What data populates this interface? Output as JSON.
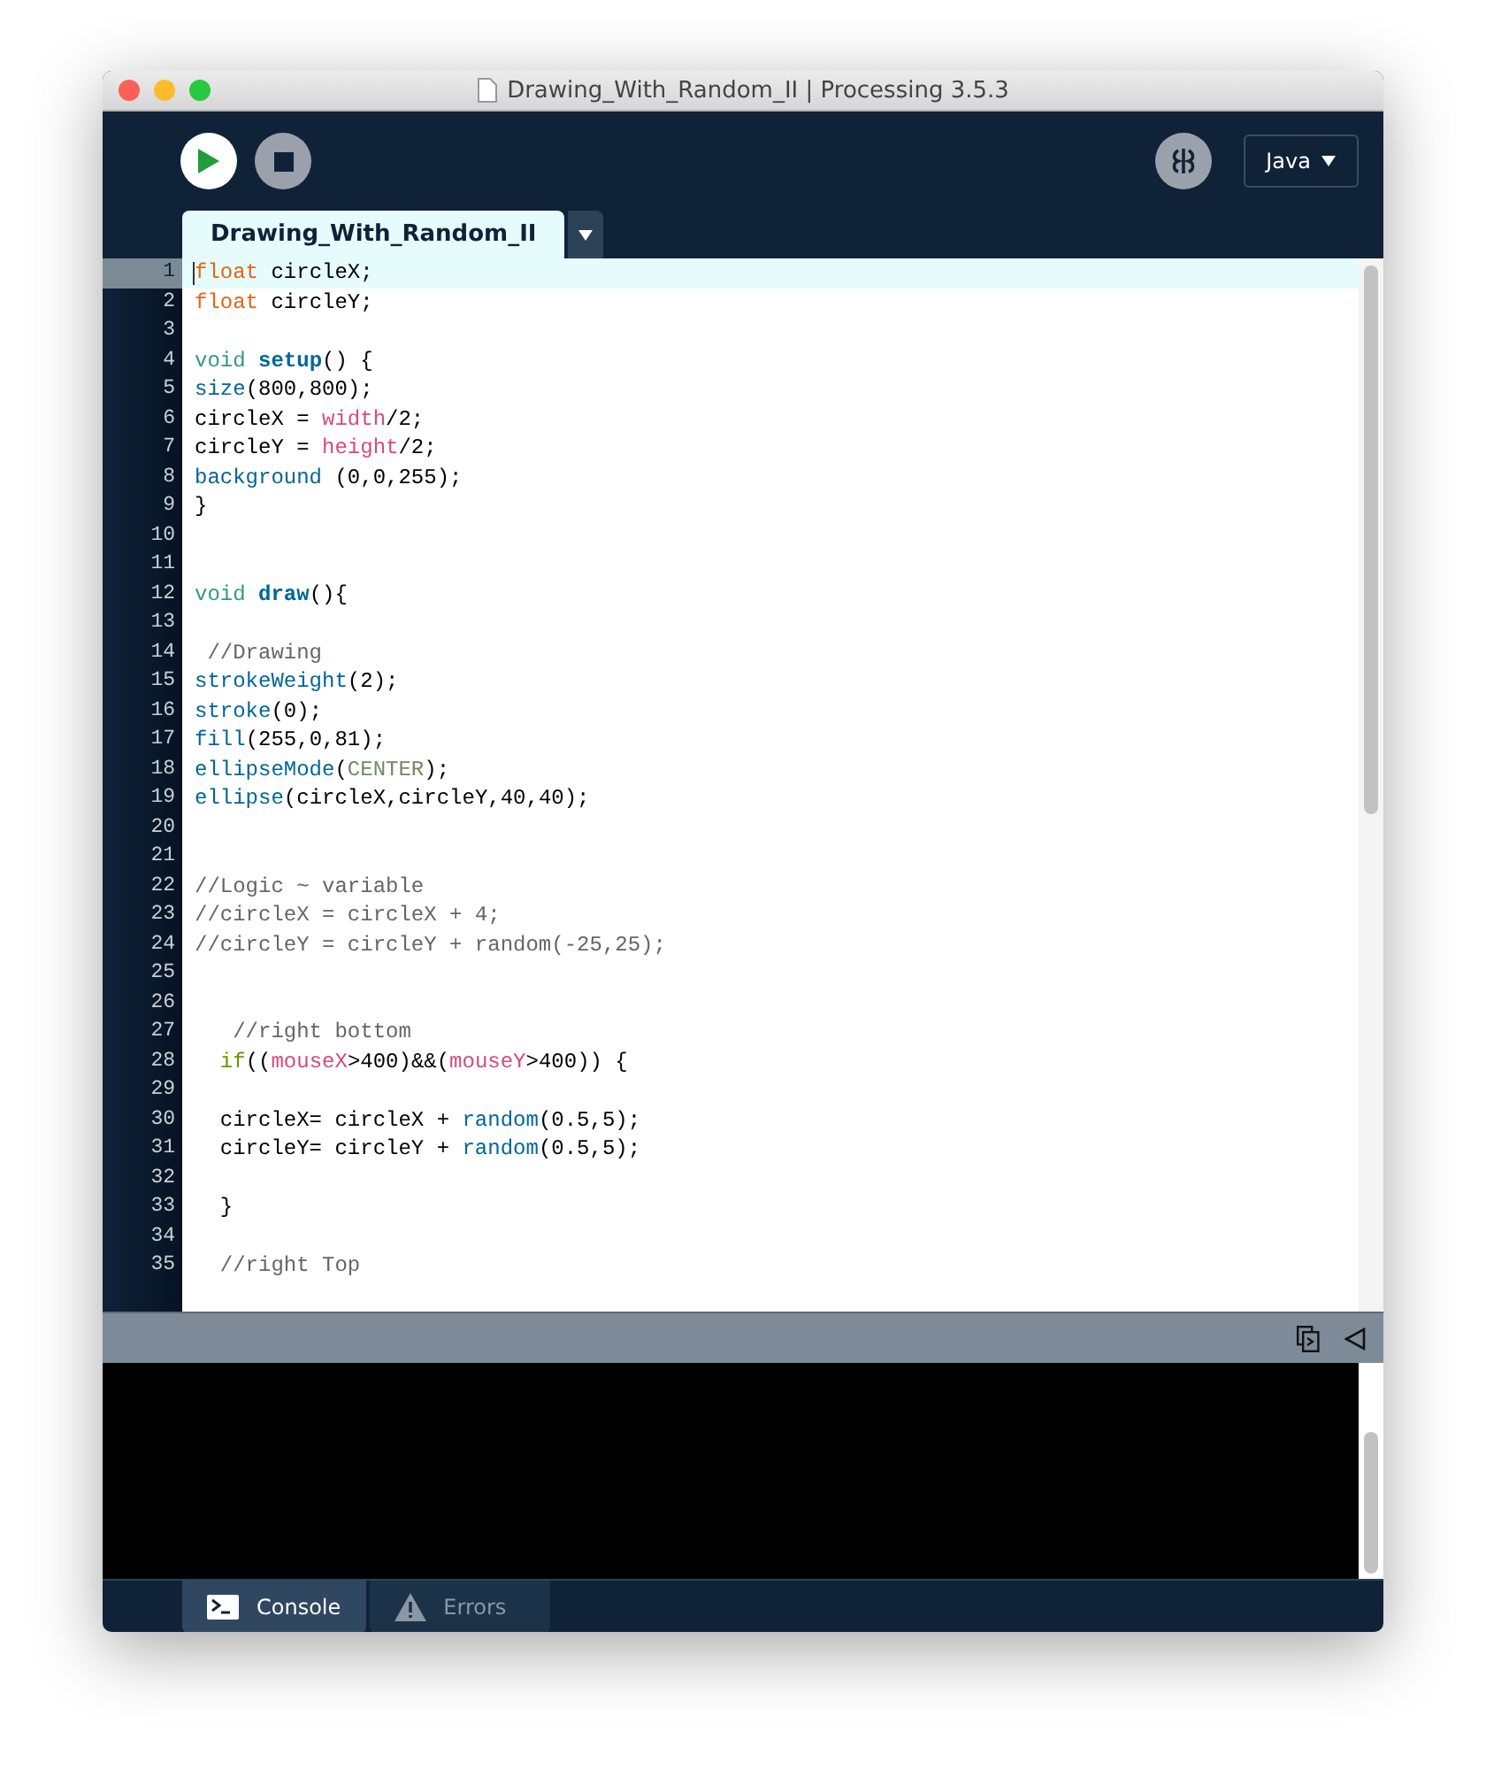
{
  "window": {
    "title": "Drawing_With_Random_II | Processing 3.5.3"
  },
  "toolbar": {
    "mode": "Java"
  },
  "editor_tabs": [
    {
      "label": "Drawing_With_Random_II",
      "selected": true
    }
  ],
  "code_lines": [
    {
      "number": "1",
      "current": true,
      "tokens": [
        {
          "kind": "type",
          "text": "float"
        },
        {
          "kind": "plain",
          "text": " circleX;"
        }
      ]
    },
    {
      "number": "2",
      "current": false,
      "tokens": [
        {
          "kind": "type",
          "text": "float"
        },
        {
          "kind": "plain",
          "text": " circleY;"
        }
      ]
    },
    {
      "number": "3",
      "current": false
    },
    {
      "number": "4",
      "current": false,
      "tokens": [
        {
          "kind": "keyword",
          "text": "void "
        },
        {
          "kind": "function",
          "text": "setup"
        },
        {
          "kind": "plain",
          "text": "() {"
        }
      ]
    },
    {
      "number": "5",
      "current": false,
      "tokens": [
        {
          "kind": "builtin",
          "text": "size"
        },
        {
          "kind": "plain",
          "text": "(800,800);"
        }
      ]
    },
    {
      "number": "6",
      "current": false,
      "tokens": [
        {
          "kind": "plain",
          "text": "circleX = "
        },
        {
          "kind": "variable",
          "text": "width"
        },
        {
          "kind": "plain",
          "text": "/2;"
        }
      ]
    },
    {
      "number": "7",
      "current": false,
      "tokens": [
        {
          "kind": "plain",
          "text": "circleY = "
        },
        {
          "kind": "variable",
          "text": "height"
        },
        {
          "kind": "plain",
          "text": "/2;"
        }
      ]
    },
    {
      "number": "8",
      "current": false,
      "tokens": [
        {
          "kind": "builtin",
          "text": "background"
        },
        {
          "kind": "plain",
          "text": " (0,0,255);"
        }
      ]
    },
    {
      "number": "9",
      "current": false,
      "tokens": [
        {
          "kind": "plain",
          "text": "}"
        }
      ]
    },
    {
      "number": "10",
      "current": false
    },
    {
      "number": "11",
      "current": false
    },
    {
      "number": "12",
      "current": false,
      "tokens": [
        {
          "kind": "keyword",
          "text": "void "
        },
        {
          "kind": "function",
          "text": "draw"
        },
        {
          "kind": "plain",
          "text": "(){"
        }
      ]
    },
    {
      "number": "13",
      "current": false
    },
    {
      "number": "14",
      "current": false,
      "tokens": [
        {
          "kind": "comment",
          "text": " //Drawing"
        }
      ]
    },
    {
      "number": "15",
      "current": false,
      "tokens": [
        {
          "kind": "builtin",
          "text": "strokeWeight"
        },
        {
          "kind": "plain",
          "text": "(2);"
        }
      ]
    },
    {
      "number": "16",
      "current": false,
      "tokens": [
        {
          "kind": "builtin",
          "text": "stroke"
        },
        {
          "kind": "plain",
          "text": "(0);"
        }
      ]
    },
    {
      "number": "17",
      "current": false,
      "tokens": [
        {
          "kind": "builtin",
          "text": "fill"
        },
        {
          "kind": "plain",
          "text": "(255,0,81);"
        }
      ]
    },
    {
      "number": "18",
      "current": false,
      "tokens": [
        {
          "kind": "builtin",
          "text": "ellipseMode"
        },
        {
          "kind": "plain",
          "text": "("
        },
        {
          "kind": "constant",
          "text": "CENTER"
        },
        {
          "kind": "plain",
          "text": ");"
        }
      ]
    },
    {
      "number": "19",
      "current": false,
      "tokens": [
        {
          "kind": "builtin",
          "text": "ellipse"
        },
        {
          "kind": "plain",
          "text": "(circleX,circleY,40,40);"
        }
      ]
    },
    {
      "number": "20",
      "current": false
    },
    {
      "number": "21",
      "current": false
    },
    {
      "number": "22",
      "current": false,
      "tokens": [
        {
          "kind": "comment",
          "text": "//Logic ~ variable"
        }
      ]
    },
    {
      "number": "23",
      "current": false,
      "tokens": [
        {
          "kind": "comment",
          "text": "//circleX = circleX + 4;"
        }
      ]
    },
    {
      "number": "24",
      "current": false,
      "tokens": [
        {
          "kind": "comment",
          "text": "//circleY = circleY + random(-25,25);"
        }
      ]
    },
    {
      "number": "25",
      "current": false
    },
    {
      "number": "26",
      "current": false
    },
    {
      "number": "27",
      "current": false,
      "tokens": [
        {
          "kind": "comment",
          "text": "   //right bottom"
        }
      ]
    },
    {
      "number": "28",
      "current": false,
      "tokens": [
        {
          "kind": "control",
          "text": "  if"
        },
        {
          "kind": "plain",
          "text": "(("
        },
        {
          "kind": "variable",
          "text": "mouseX"
        },
        {
          "kind": "plain",
          "text": ">400)&&("
        },
        {
          "kind": "variable",
          "text": "mouseY"
        },
        {
          "kind": "plain",
          "text": ">400)) {"
        }
      ]
    },
    {
      "number": "29",
      "current": false
    },
    {
      "number": "30",
      "current": false,
      "tokens": [
        {
          "kind": "plain",
          "text": "  circleX= circleX + "
        },
        {
          "kind": "builtin",
          "text": "random"
        },
        {
          "kind": "plain",
          "text": "(0.5,5);"
        }
      ]
    },
    {
      "number": "31",
      "current": false,
      "tokens": [
        {
          "kind": "plain",
          "text": "  circleY= circleY + "
        },
        {
          "kind": "builtin",
          "text": "random"
        },
        {
          "kind": "plain",
          "text": "(0.5,5);"
        }
      ]
    },
    {
      "number": "32",
      "current": false
    },
    {
      "number": "33",
      "current": false,
      "tokens": [
        {
          "kind": "plain",
          "text": "  }"
        }
      ]
    },
    {
      "number": "34",
      "current": false
    },
    {
      "number": "35",
      "current": false,
      "tokens": [
        {
          "kind": "comment",
          "text": "  //right Top"
        }
      ]
    }
  ],
  "console_tabs": [
    {
      "label": "Console",
      "kind": "console",
      "selected": true
    },
    {
      "label": "Errors",
      "kind": "errors",
      "selected": false
    }
  ]
}
